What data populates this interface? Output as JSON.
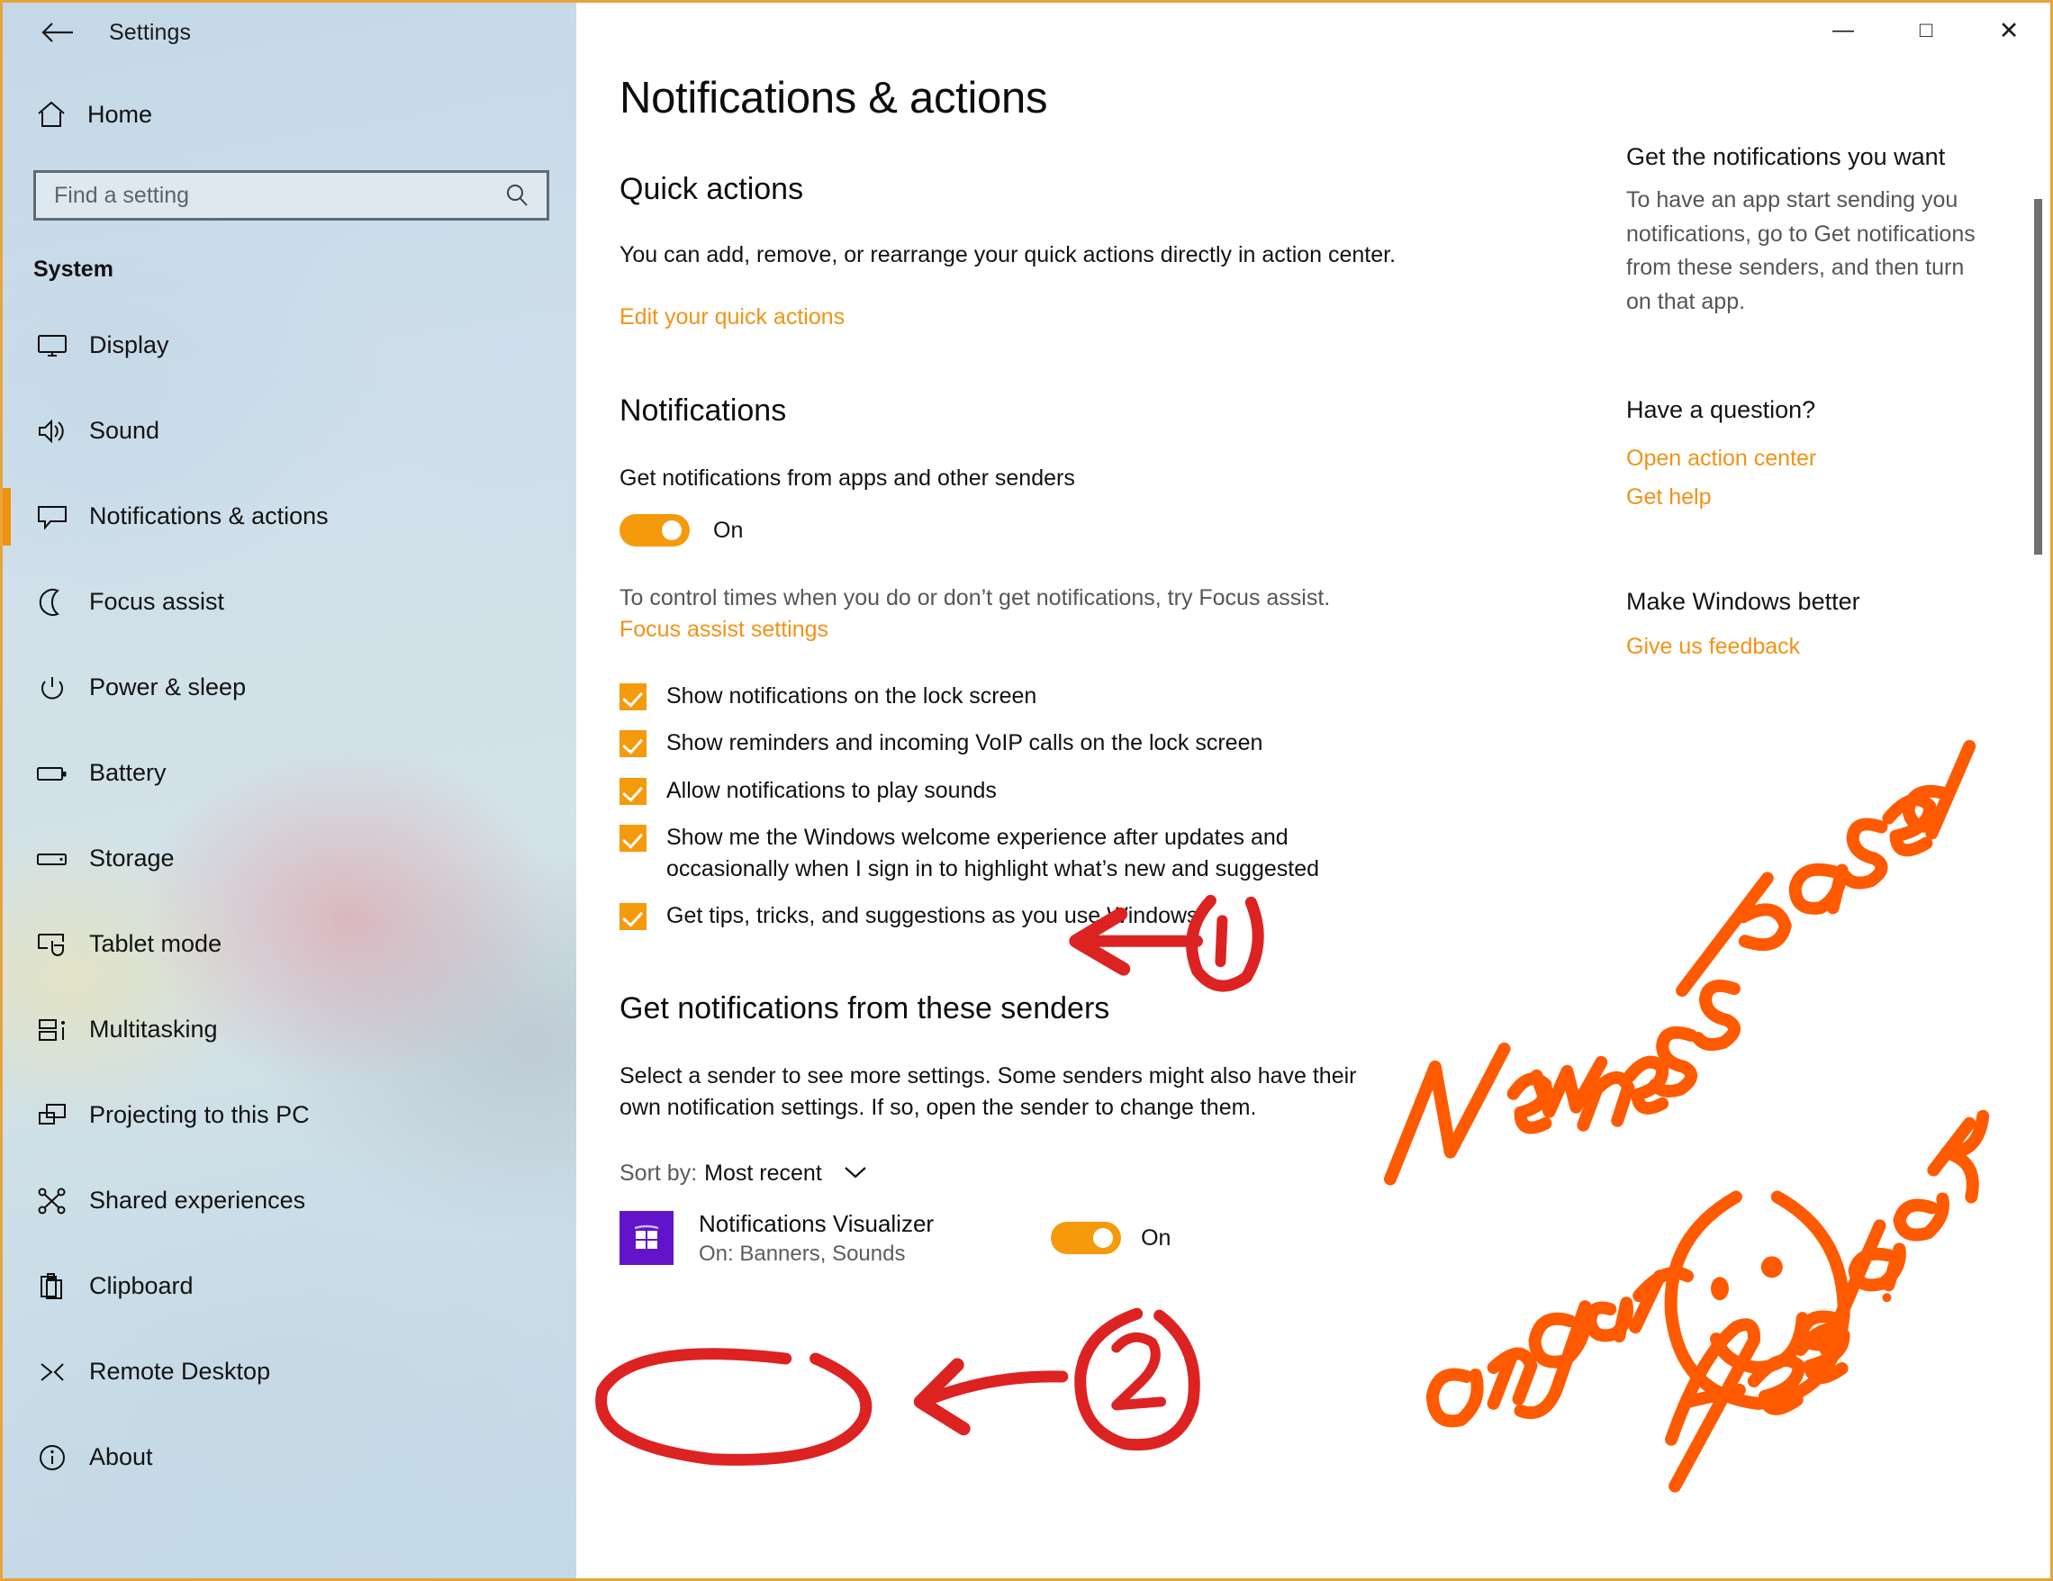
{
  "window": {
    "title": "Settings",
    "back_icon": "back-arrow-icon",
    "controls": {
      "minimize": "—",
      "maximize": "□",
      "close": "✕"
    }
  },
  "sidebar": {
    "home_label": "Home",
    "home_icon": "home-icon",
    "search": {
      "placeholder": "Find a setting",
      "icon": "search-icon",
      "value": ""
    },
    "group_title": "System",
    "items": [
      {
        "label": "Display",
        "icon": "monitor-icon",
        "active": false
      },
      {
        "label": "Sound",
        "icon": "speaker-icon",
        "active": false
      },
      {
        "label": "Notifications & actions",
        "icon": "speech-bubble-icon",
        "active": true
      },
      {
        "label": "Focus assist",
        "icon": "moon-icon",
        "active": false
      },
      {
        "label": "Power & sleep",
        "icon": "power-icon",
        "active": false
      },
      {
        "label": "Battery",
        "icon": "battery-icon",
        "active": false
      },
      {
        "label": "Storage",
        "icon": "drive-icon",
        "active": false
      },
      {
        "label": "Tablet mode",
        "icon": "tablet-touch-icon",
        "active": false
      },
      {
        "label": "Multitasking",
        "icon": "multitasking-icon",
        "active": false
      },
      {
        "label": "Projecting to this PC",
        "icon": "project-screen-icon",
        "active": false
      },
      {
        "label": "Shared experiences",
        "icon": "share-nodes-icon",
        "active": false
      },
      {
        "label": "Clipboard",
        "icon": "clipboard-icon",
        "active": false
      },
      {
        "label": "Remote Desktop",
        "icon": "remote-desktop-icon",
        "active": false
      },
      {
        "label": "About",
        "icon": "info-circle-icon",
        "active": false
      }
    ]
  },
  "main": {
    "page_title": "Notifications & actions",
    "quick_actions": {
      "heading": "Quick actions",
      "description": "You can add, remove, or rearrange your quick actions directly in action center.",
      "link": "Edit your quick actions"
    },
    "notifications": {
      "heading": "Notifications",
      "toggle_label": "Get notifications from apps and other senders",
      "toggle_state": "On",
      "hint": "To control times when you do or don’t get notifications, try Focus assist.",
      "hint_link": "Focus assist settings",
      "checkboxes": [
        {
          "label": "Show notifications on the lock screen",
          "checked": true
        },
        {
          "label": "Show reminders and incoming VoIP calls on the lock screen",
          "checked": true
        },
        {
          "label": "Allow notifications to play sounds",
          "checked": true
        },
        {
          "label": "Show me the Windows welcome experience after updates and occasionally when I sign in to highlight what’s new and suggested",
          "checked": true
        },
        {
          "label": "Get tips, tricks, and suggestions as you use Windows",
          "checked": true
        }
      ]
    },
    "senders": {
      "heading": "Get notifications from these senders",
      "description": "Select a sender to see more settings. Some senders might also have their own notification settings. If so, open the sender to change them.",
      "sort_label": "Sort by:",
      "sort_value": "Most recent",
      "sort_icon": "chevron-down-icon",
      "apps": [
        {
          "name": "Notifications Visualizer",
          "status": "On: Banners, Sounds",
          "toggle_state": "On",
          "icon": "notifications-visualizer-tile",
          "tile_color": "#6114c9"
        }
      ]
    }
  },
  "right_panel": {
    "sections": [
      {
        "heading": "Get the notifications you want",
        "paragraph": "To have an app start sending you notifications, go to Get notifications from these senders, and then turn on that app."
      },
      {
        "heading": "Have a question?",
        "links": [
          "Open action center",
          "Get help"
        ]
      },
      {
        "heading": "Make Windows better",
        "links": [
          "Give us feedback"
        ]
      }
    ]
  },
  "annotations": {
    "handwriting": "Newness based on your feedback",
    "marker_1": "1",
    "marker_2": "2",
    "smiley": "smiley-face",
    "ink_color_red": "#dd2222",
    "ink_color_orange": "#ff5a00"
  },
  "theme": {
    "accent": "#f29216",
    "toggle_on": "#f59a0b",
    "window_border": "#e8a33d"
  }
}
